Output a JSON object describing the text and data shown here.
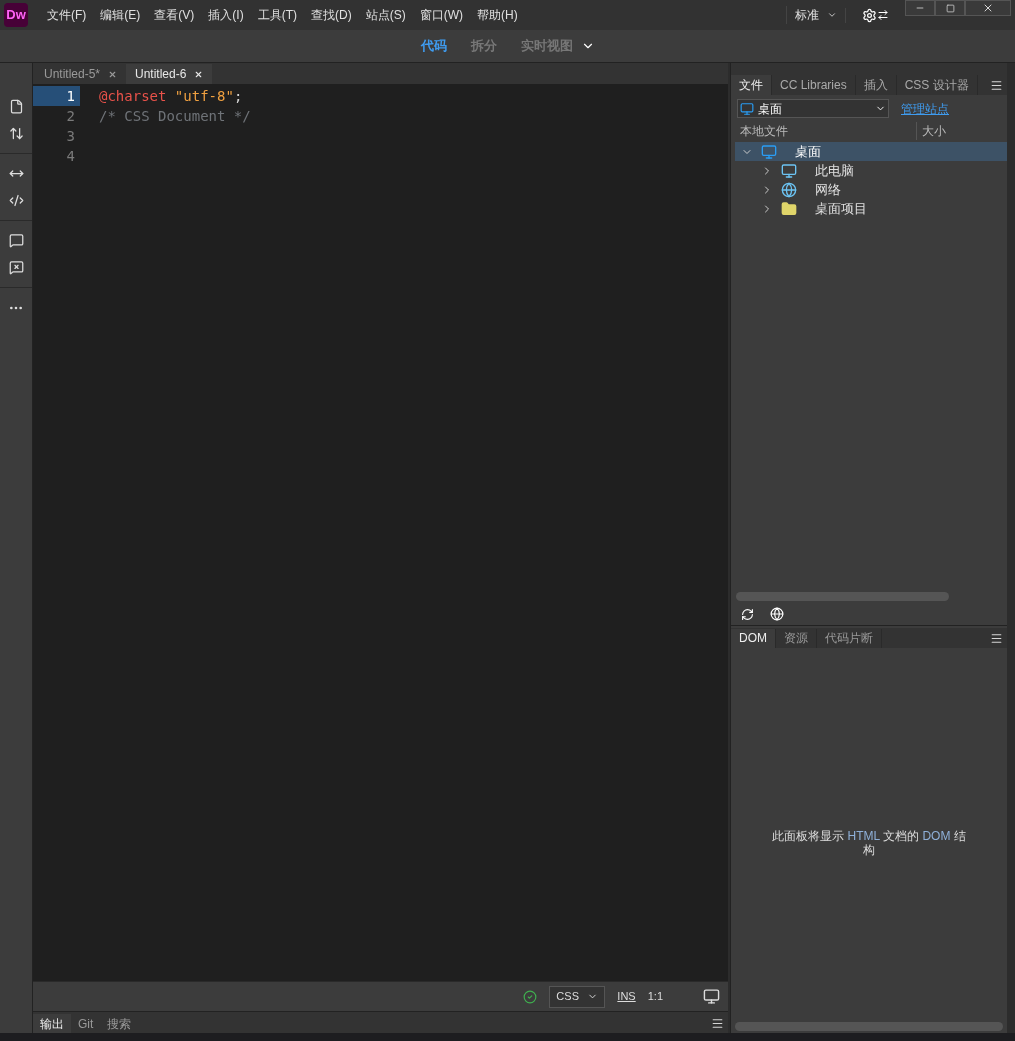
{
  "menubar": {
    "logo": "Dw",
    "menus": [
      "文件(F)",
      "编辑(E)",
      "查看(V)",
      "插入(I)",
      "工具(T)",
      "查找(D)",
      "站点(S)",
      "窗口(W)",
      "帮助(H)"
    ],
    "workspace": "标准"
  },
  "view_switcher": [
    {
      "label": "代码",
      "selected": true
    },
    {
      "label": "拆分",
      "selected": false
    },
    {
      "label": "实时视图",
      "selected": false
    }
  ],
  "document_tabs": [
    {
      "label": "Untitled-5*",
      "selected": false
    },
    {
      "label": "Untitled-6",
      "selected": true
    }
  ],
  "code": {
    "lines": [
      {
        "number": "1",
        "current": true,
        "tokens": [
          {
            "kind": "keyword",
            "text": "@charset"
          },
          {
            "kind": "string",
            "text": "\"utf-8\""
          },
          {
            "kind": "punct",
            "text": ";"
          }
        ]
      },
      {
        "number": "2",
        "current": false,
        "tokens": [
          {
            "kind": "comment",
            "text": "/* CSS Document */"
          }
        ]
      },
      {
        "number": "3",
        "current": false
      },
      {
        "number": "4",
        "current": false
      }
    ]
  },
  "status_bar": {
    "valid": true,
    "language": "CSS",
    "mode": "INS",
    "position": "1:1"
  },
  "bottom_tabs": [
    {
      "label": "输出",
      "selected": true
    },
    {
      "label": "Git",
      "selected": false
    },
    {
      "label": "搜索",
      "selected": false
    }
  ],
  "files_panel": {
    "tabs": [
      {
        "label": "文件",
        "selected": true
      },
      {
        "label": "CC Libraries",
        "selected": false
      },
      {
        "label": "插入",
        "selected": false
      },
      {
        "label": "CSS 设计器",
        "selected": false
      }
    ],
    "site": "桌面",
    "manage_link": "管理站点",
    "columns": [
      "本地文件",
      "大小"
    ],
    "tree": [
      {
        "label": "桌面",
        "kind": "desktop",
        "selected": true,
        "expanded": true,
        "children": [
          {
            "label": "此电脑",
            "kind": "computer",
            "selected": false,
            "expanded": false
          },
          {
            "label": "网络",
            "kind": "network",
            "selected": false,
            "expanded": false
          },
          {
            "label": "桌面项目",
            "kind": "folder",
            "selected": false,
            "expanded": false
          }
        ]
      }
    ]
  },
  "dom_panel": {
    "tabs": [
      {
        "label": "DOM",
        "selected": true
      },
      {
        "label": "资源",
        "selected": false
      },
      {
        "label": "代码片断",
        "selected": false
      }
    ],
    "message": [
      {
        "kind": "plain",
        "text": "此面板将显示 "
      },
      {
        "kind": "term",
        "text": "HTML"
      },
      {
        "kind": "plain",
        "text": " 文档的 "
      },
      {
        "kind": "term",
        "text": "DOM"
      },
      {
        "kind": "plain",
        "text": " 结构"
      }
    ]
  }
}
